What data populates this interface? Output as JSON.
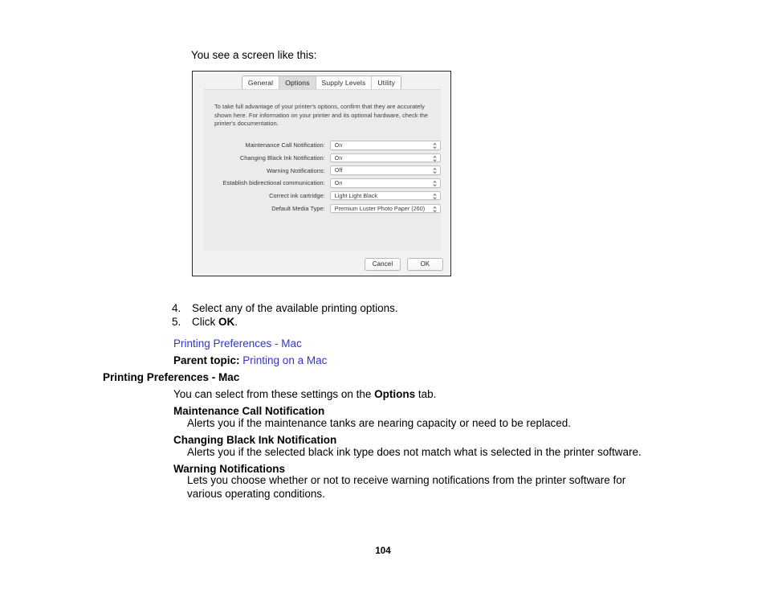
{
  "document": {
    "intro_line": "You see a screen like this:",
    "page_number": "104"
  },
  "dialog": {
    "tabs": [
      {
        "label": "General",
        "active": false
      },
      {
        "label": "Options",
        "active": true
      },
      {
        "label": "Supply Levels",
        "active": false
      },
      {
        "label": "Utility",
        "active": false
      }
    ],
    "description": "To take full advantage of your printer's options, confirm that they are accurately shown here. For information on your printer and its optional hardware, check the printer's documentation.",
    "settings": [
      {
        "label": "Maintenance Call Notification:",
        "value": "On"
      },
      {
        "label": "Changing Black Ink Notification:",
        "value": "On"
      },
      {
        "label": "Warning Notifications:",
        "value": "Off"
      },
      {
        "label": "Establish bidirectional communication:",
        "value": "On"
      },
      {
        "label": "Correct ink cartridge:",
        "value": "Light Light Black"
      },
      {
        "label": "Default Media Type:",
        "value": "Premium Luster Photo Paper (260)"
      }
    ],
    "buttons": {
      "cancel": "Cancel",
      "ok": "OK"
    }
  },
  "steps": [
    {
      "number": "4.",
      "text": "Select any of the available printing options."
    },
    {
      "number": "5.",
      "text_before": "Click ",
      "bold": "OK",
      "text_after": "."
    }
  ],
  "links": {
    "printing_preferences_mac": "Printing Preferences - Mac",
    "parent_topic_label": "Parent topic:",
    "parent_topic_link": "Printing on a Mac"
  },
  "section": {
    "title": "Printing Preferences - Mac",
    "lead_before": "You can select from these settings on the ",
    "lead_bold": "Options",
    "lead_after": " tab.",
    "definitions": [
      {
        "term": "Maintenance Call Notification",
        "description": "Alerts you if the maintenance tanks are nearing capacity or need to be replaced."
      },
      {
        "term": "Changing Black Ink Notification",
        "description": "Alerts you if the selected black ink type does not match what is selected in the printer software."
      },
      {
        "term": "Warning Notifications",
        "description": "Lets you choose whether or not to receive warning notifications from the printer software for various operating conditions."
      }
    ]
  },
  "colors": {
    "link": "#3333cc",
    "dialog_bg": "#f2f2f2",
    "panel_bg": "#ebebeb"
  }
}
